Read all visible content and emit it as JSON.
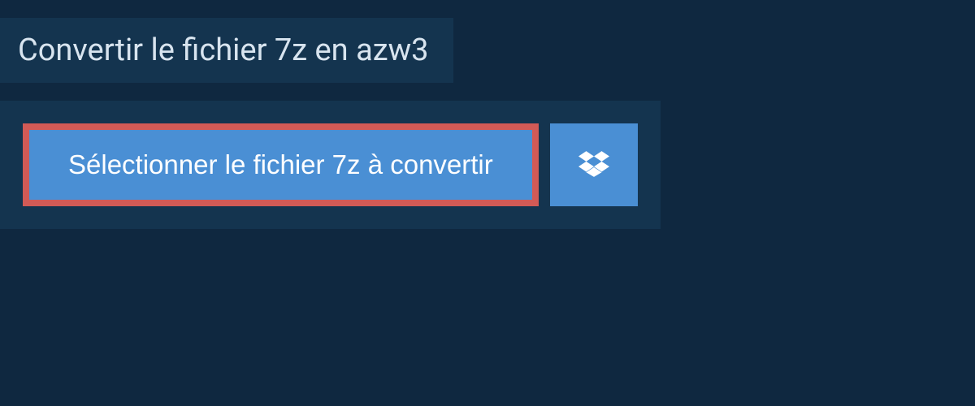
{
  "header": {
    "title": "Convertir le fichier 7z en azw3"
  },
  "actions": {
    "select_file_label": "Sélectionner le fichier 7z à convertir"
  }
}
